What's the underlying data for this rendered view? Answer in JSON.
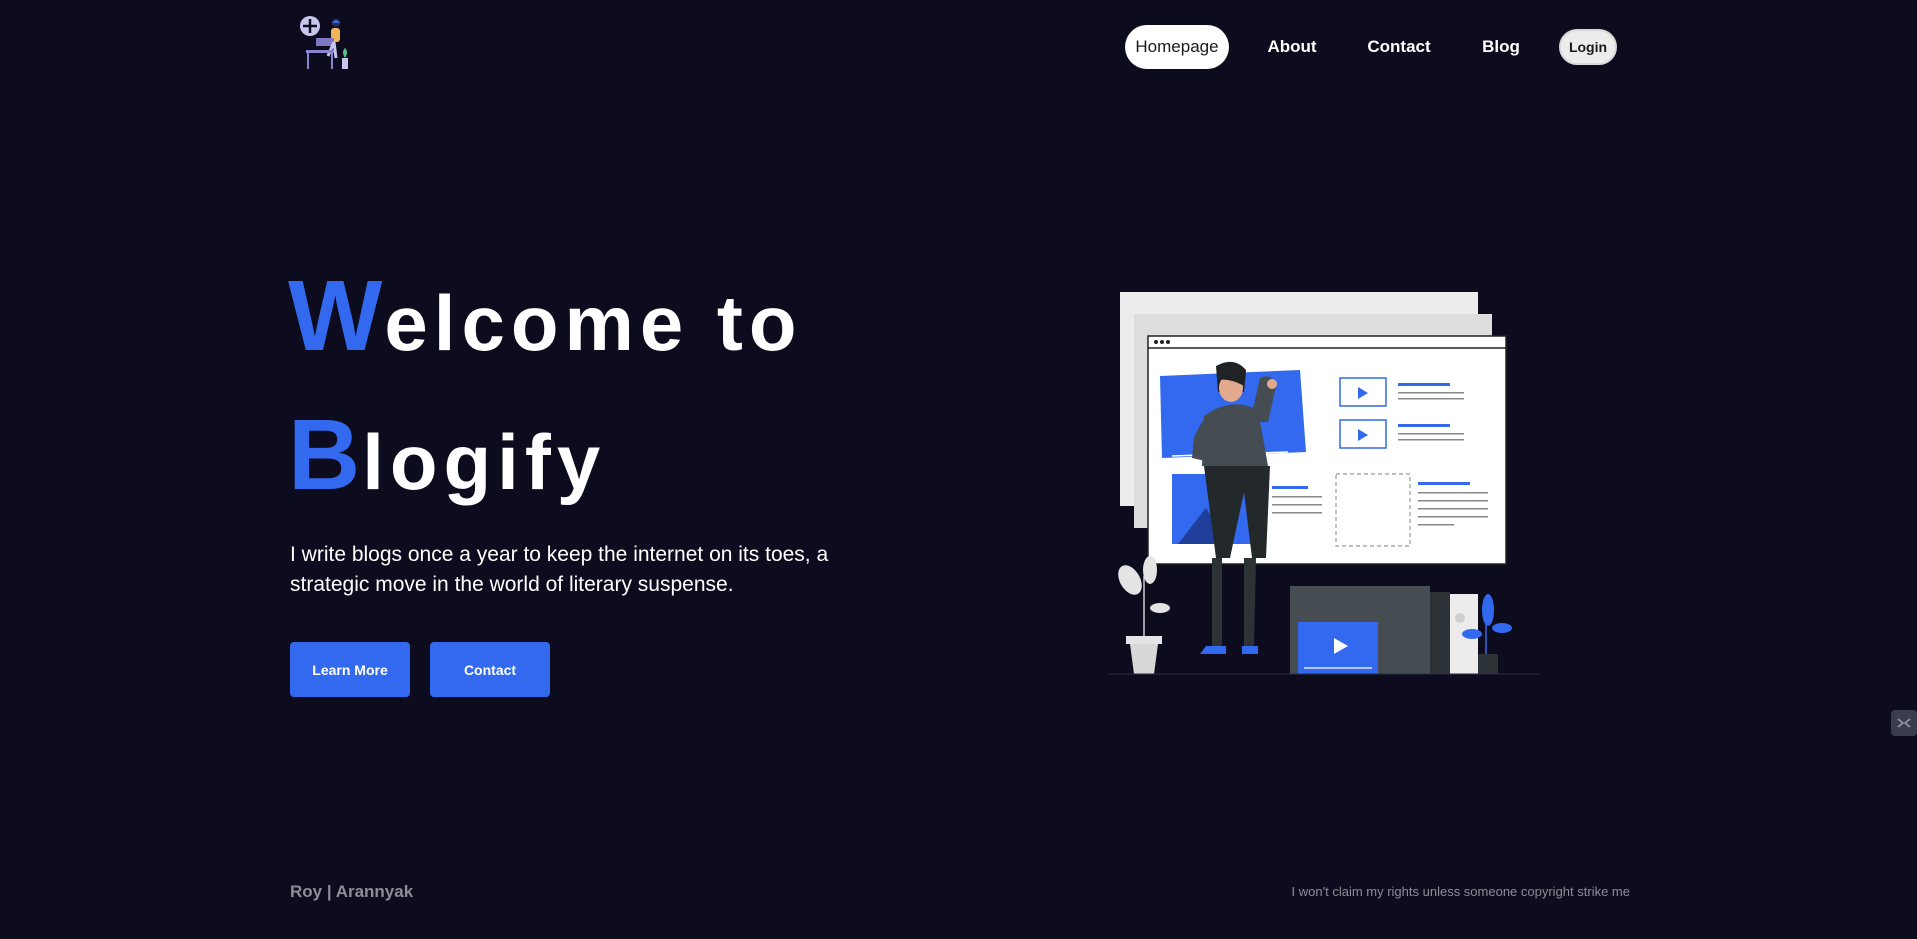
{
  "nav": {
    "items": [
      {
        "label": "Homepage",
        "active": true
      },
      {
        "label": "About"
      },
      {
        "label": "Contact"
      },
      {
        "label": "Blog"
      }
    ],
    "login_label": "Login"
  },
  "hero": {
    "line1_initial": "W",
    "line1_rest": "elcome to",
    "line2_initial": "B",
    "line2_rest": "logify",
    "description": "I write blogs once a year to keep the internet on its toes, a strategic move in the world of literary suspense.",
    "learn_more_label": "Learn More",
    "contact_label": "Contact"
  },
  "footer": {
    "author": "Roy | Arannyak",
    "disclaimer": "I won't claim my rights unless someone copyright strike me"
  },
  "colors": {
    "background": "#0d0c1f",
    "accent": "#3369ee",
    "text": "#ffffff",
    "muted": "#8d8d97"
  },
  "icons": {
    "logo": "person-at-desk-logo-icon",
    "illustration": "man-at-content-board-illustration",
    "side_widget": "floating-widget-icon"
  }
}
